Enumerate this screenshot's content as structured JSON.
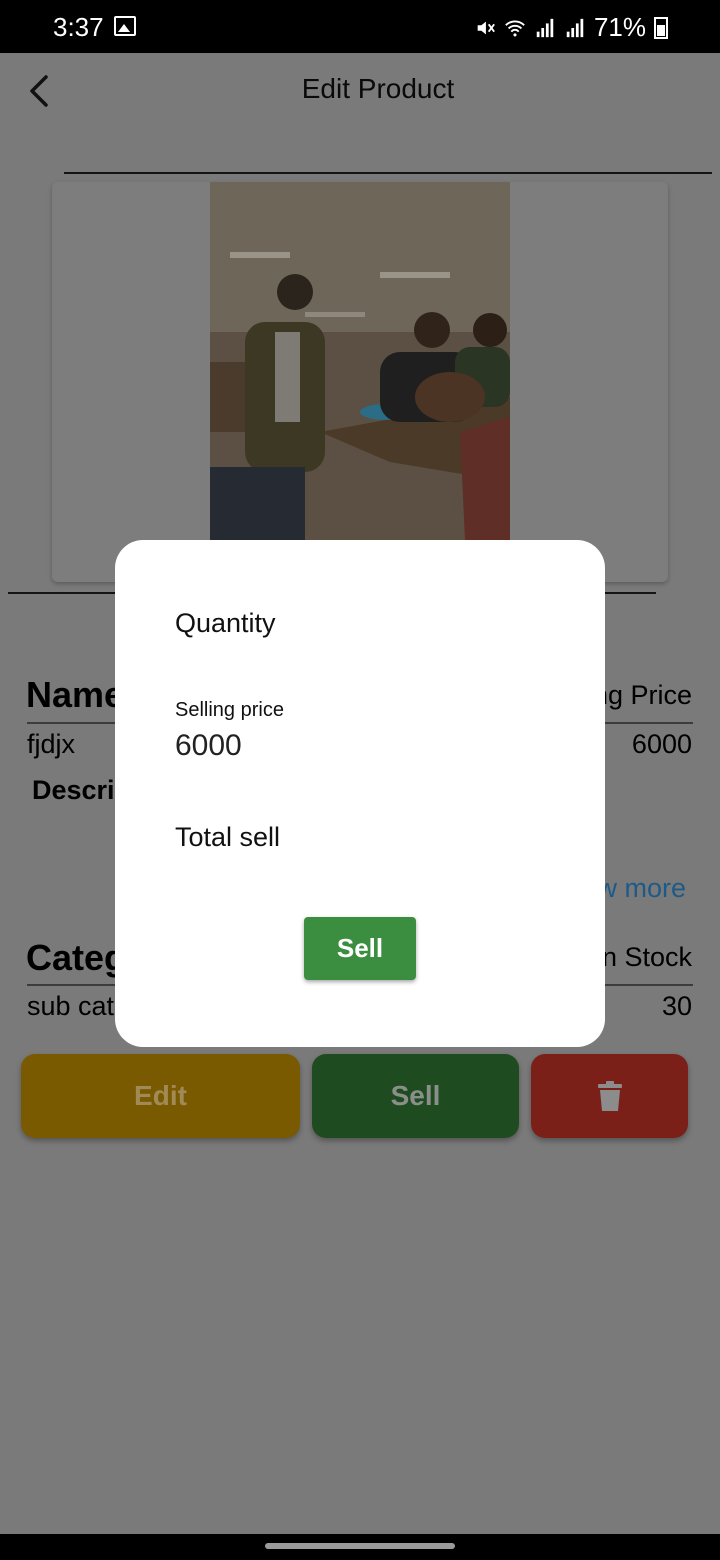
{
  "status_bar": {
    "time": "3:37",
    "battery": "71%",
    "icons": [
      "gallery-icon",
      "mute-icon",
      "wifi-icon",
      "signal-icon",
      "signal-icon",
      "battery-icon"
    ]
  },
  "app_bar": {
    "title": "Edit Product",
    "back_icon": "chevron-left-icon"
  },
  "product": {
    "name_label": "Name",
    "price_label": "Selling Price",
    "name_value": "fjdjx",
    "price_value": "6000",
    "description_label": "Description",
    "show_more": "Show more",
    "category_label": "Category",
    "stock_label": "In Stock",
    "category_value": "sub category",
    "stock_value": "30"
  },
  "actions": {
    "edit": "Edit",
    "sell": "Sell",
    "delete_icon": "trash-icon",
    "colors": {
      "edit": "#f0b400",
      "sell": "#3b8e3f",
      "delete": "#e53a2f"
    }
  },
  "dialog": {
    "quantity_label": "Quantity",
    "selling_price_label": "Selling price",
    "selling_price_value": "6000",
    "total_label": "Total sell",
    "sell_button": "Sell"
  }
}
